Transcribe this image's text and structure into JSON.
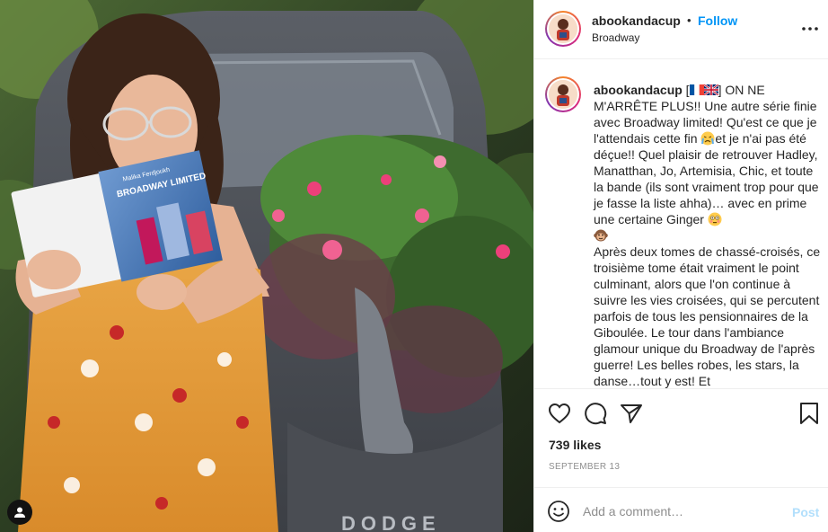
{
  "post": {
    "username": "abookandacup",
    "separator": "•",
    "follow_label": "Follow",
    "location": "Broadway",
    "more_icon": "more-horizontal-icon"
  },
  "caption": {
    "username": "abookandacup",
    "flags": [
      "france-flag",
      "uk-flag"
    ],
    "part1": " ON NE M'ARRÊTE PLUS!! Une autre série finie avec Broadway limited! Qu'est ce que je l'attendais cette fin ",
    "emoji1": "crying-face-emoji",
    "part2": "et je n'ai pas été déçue!! Quel plaisir de retrouver Hadley, Manatthan, Jo, Artemisia, Chic, et toute la bande (ils sont vraiment trop pour que je fasse la liste ahha)… avec en prime une certaine Ginger ",
    "emoji2": "flushed-face-emoji",
    "emoji3": "monkey-face-emoji",
    "part3": "Après deux tomes de chassé-croisés, ce troisième tome était vraiment le point culminant, alors que l'on continue à suivre les vies croisées, qui se percutent parfois de tous les pensionnaires de la Giboulée. Le tour dans l'ambiance glamour unique du Broadway de l'après guerre! Les belles robes, les stars, la danse…tout y est! Et"
  },
  "actions": {
    "like_icon": "heart-icon",
    "comment_icon": "comment-icon",
    "share_icon": "paper-plane-icon",
    "save_icon": "bookmark-icon"
  },
  "stats": {
    "likes": "739 likes",
    "date": "SEPTEMBER 13"
  },
  "comment_box": {
    "emoji_icon": "smiley-icon",
    "placeholder": "Add a comment…",
    "post_label": "Post"
  },
  "photo": {
    "book_title": "BROADWAY LIMITED",
    "book_author": "Malika Ferdjoukh",
    "car_badge": "DODGE",
    "user_tag_icon": "user-tag-icon"
  },
  "colors": {
    "accent": "#0095f6",
    "post_disabled": "#b2dffc",
    "muted": "#8e8e8e",
    "text": "#262626"
  }
}
